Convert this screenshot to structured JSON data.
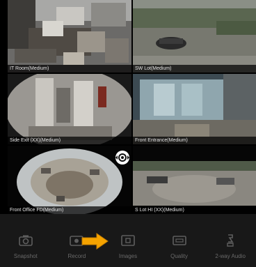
{
  "cameras": [
    {
      "label": "IT Room(Medium)"
    },
    {
      "label": "SW Lot(Medium)"
    },
    {
      "label": "Side Exit (XX)(Medium)"
    },
    {
      "label": "Front Entrance(Medium)"
    },
    {
      "label": "Front Office FD(Medium)"
    },
    {
      "label": "S Lot HI (XX)(Medium)"
    }
  ],
  "toolbar": {
    "items": [
      {
        "label": "Snapshot",
        "icon": "camera-icon"
      },
      {
        "label": "Record",
        "icon": "record-icon"
      },
      {
        "label": "Images",
        "icon": "images-icon"
      },
      {
        "label": "Quality",
        "icon": "quality-icon"
      },
      {
        "label": "2-way Audio",
        "icon": "audio-icon"
      }
    ]
  },
  "colors": {
    "toolbar_bg": "#181818",
    "icon_color": "#5e5e5e",
    "arrow": "#f5a300"
  }
}
